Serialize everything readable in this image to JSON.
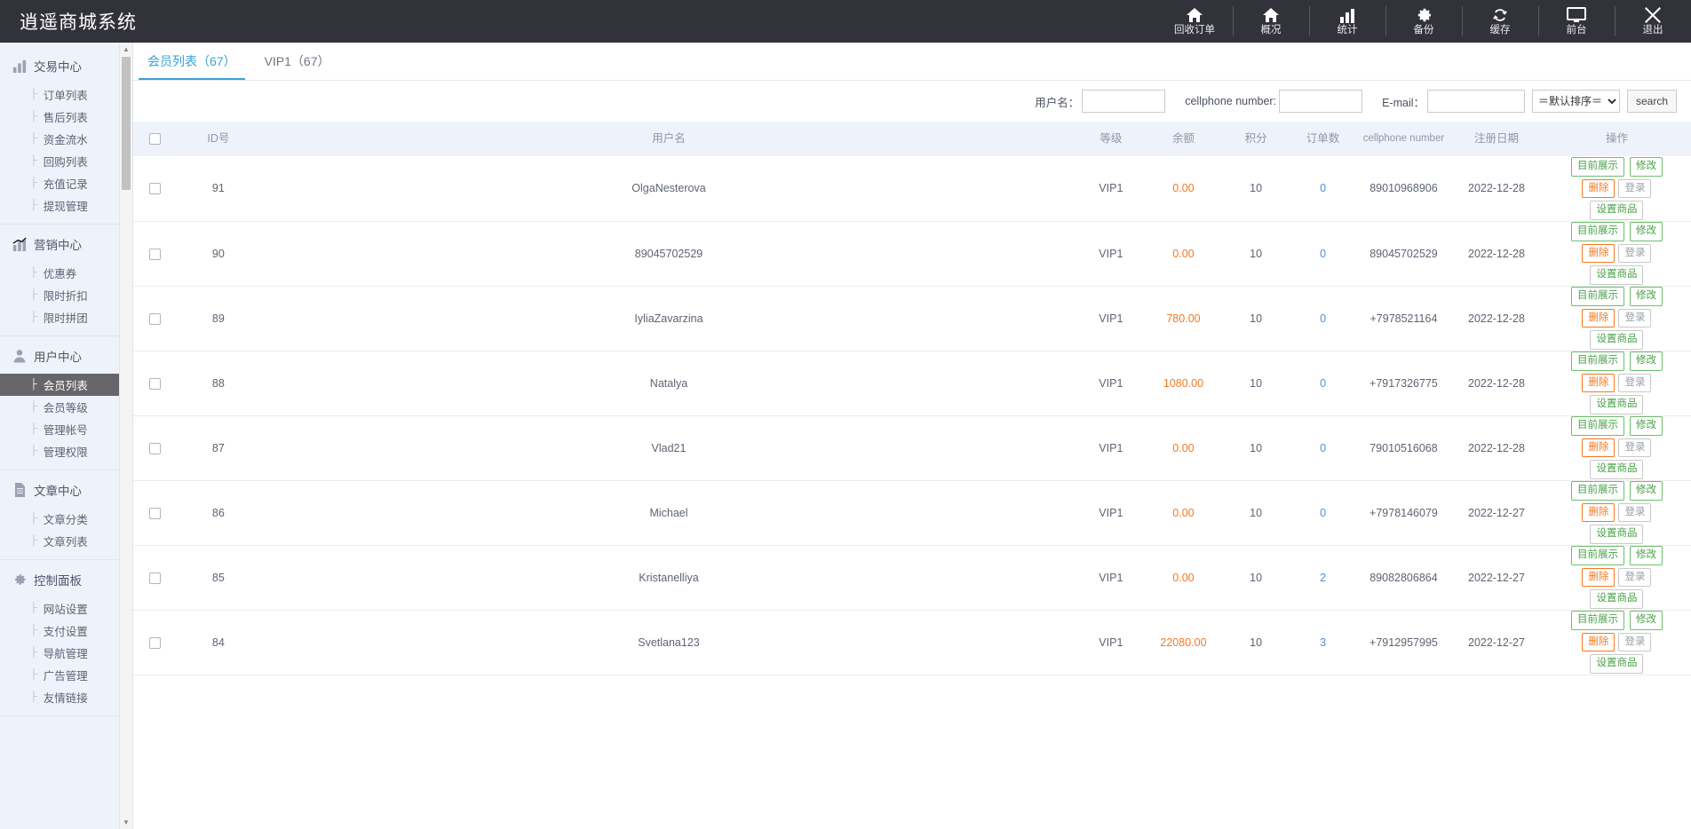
{
  "header": {
    "brand": "逍遥商城系统",
    "nav": [
      {
        "label": "回收订单",
        "icon": "home-icon"
      },
      {
        "label": "概况",
        "icon": "home-icon"
      },
      {
        "label": "统计",
        "icon": "bar-chart-icon"
      },
      {
        "label": "备份",
        "icon": "gear-icon"
      },
      {
        "label": "缓存",
        "icon": "refresh-icon"
      },
      {
        "label": "前台",
        "icon": "monitor-icon"
      },
      {
        "label": "退出",
        "icon": "close-icon"
      }
    ]
  },
  "sidebar": {
    "groups": [
      {
        "label": "交易中心",
        "icon": "bar-chart-icon",
        "items": [
          "订单列表",
          "售后列表",
          "资金流水",
          "回购列表",
          "充值记录",
          "提现管理"
        ]
      },
      {
        "label": "营销中心",
        "icon": "trend-chart-icon",
        "items": [
          "优惠券",
          "限时折扣",
          "限时拼团"
        ]
      },
      {
        "label": "用户中心",
        "icon": "user-icon",
        "items": [
          "会员列表",
          "会员等级",
          "管理帐号",
          "管理权限"
        ],
        "active": "会员列表"
      },
      {
        "label": "文章中心",
        "icon": "document-icon",
        "items": [
          "文章分类",
          "文章列表"
        ]
      },
      {
        "label": "控制面板",
        "icon": "gear-icon",
        "items": [
          "网站设置",
          "支付设置",
          "导航管理",
          "广告管理",
          "友情链接"
        ]
      }
    ]
  },
  "tabs": [
    {
      "label": "会员列表（67）",
      "active": true
    },
    {
      "label": "VIP1（67）",
      "active": false
    }
  ],
  "search": {
    "username_label": "用户名：",
    "username_value": "",
    "cellphone_label": "cellphone number:",
    "cellphone_value": "",
    "email_label": "E-mail：",
    "email_value": "",
    "sort_selected": "＝默认排序＝",
    "sort_options": [
      "＝默认排序＝"
    ],
    "search_button": "search"
  },
  "table": {
    "columns": [
      "ID号",
      "用户名",
      "等级",
      "余额",
      "积分",
      "订单数",
      "cellphone number",
      "注册日期",
      "操作"
    ],
    "actions": {
      "show": "目前展示",
      "edit": "修改",
      "delete": "删除",
      "login": "登录",
      "goods": "设置商品"
    },
    "rows": [
      {
        "id": "91",
        "username": "OlgaNesterova",
        "level": "VIP1",
        "balance": "0.00",
        "points": "10",
        "orders": "0",
        "cellphone": "89010968906",
        "date": "2022-12-28"
      },
      {
        "id": "90",
        "username": "89045702529",
        "level": "VIP1",
        "balance": "0.00",
        "points": "10",
        "orders": "0",
        "cellphone": "89045702529",
        "date": "2022-12-28"
      },
      {
        "id": "89",
        "username": "IyliaZavarzina",
        "level": "VIP1",
        "balance": "780.00",
        "points": "10",
        "orders": "0",
        "cellphone": "+7978521164",
        "date": "2022-12-28"
      },
      {
        "id": "88",
        "username": "Natalya",
        "level": "VIP1",
        "balance": "1080.00",
        "points": "10",
        "orders": "0",
        "cellphone": "+7917326775",
        "date": "2022-12-28"
      },
      {
        "id": "87",
        "username": "Vlad21",
        "level": "VIP1",
        "balance": "0.00",
        "points": "10",
        "orders": "0",
        "cellphone": "79010516068",
        "date": "2022-12-28"
      },
      {
        "id": "86",
        "username": "Michael",
        "level": "VIP1",
        "balance": "0.00",
        "points": "10",
        "orders": "0",
        "cellphone": "+7978146079",
        "date": "2022-12-27"
      },
      {
        "id": "85",
        "username": "Kristanelliya",
        "level": "VIP1",
        "balance": "0.00",
        "points": "10",
        "orders": "2",
        "cellphone": "89082806864",
        "date": "2022-12-27"
      },
      {
        "id": "84",
        "username": "Svetlana123",
        "level": "VIP1",
        "balance": "22080.00",
        "points": "10",
        "orders": "3",
        "cellphone": "+7912957995",
        "date": "2022-12-27"
      }
    ]
  },
  "colors": {
    "topbar": "#32323a",
    "accent": "#3aa0d8",
    "balance": "#f47920",
    "orders": "#4a90d9",
    "sidebar_bg": "#eef2fa",
    "active_item": "#66666a"
  }
}
